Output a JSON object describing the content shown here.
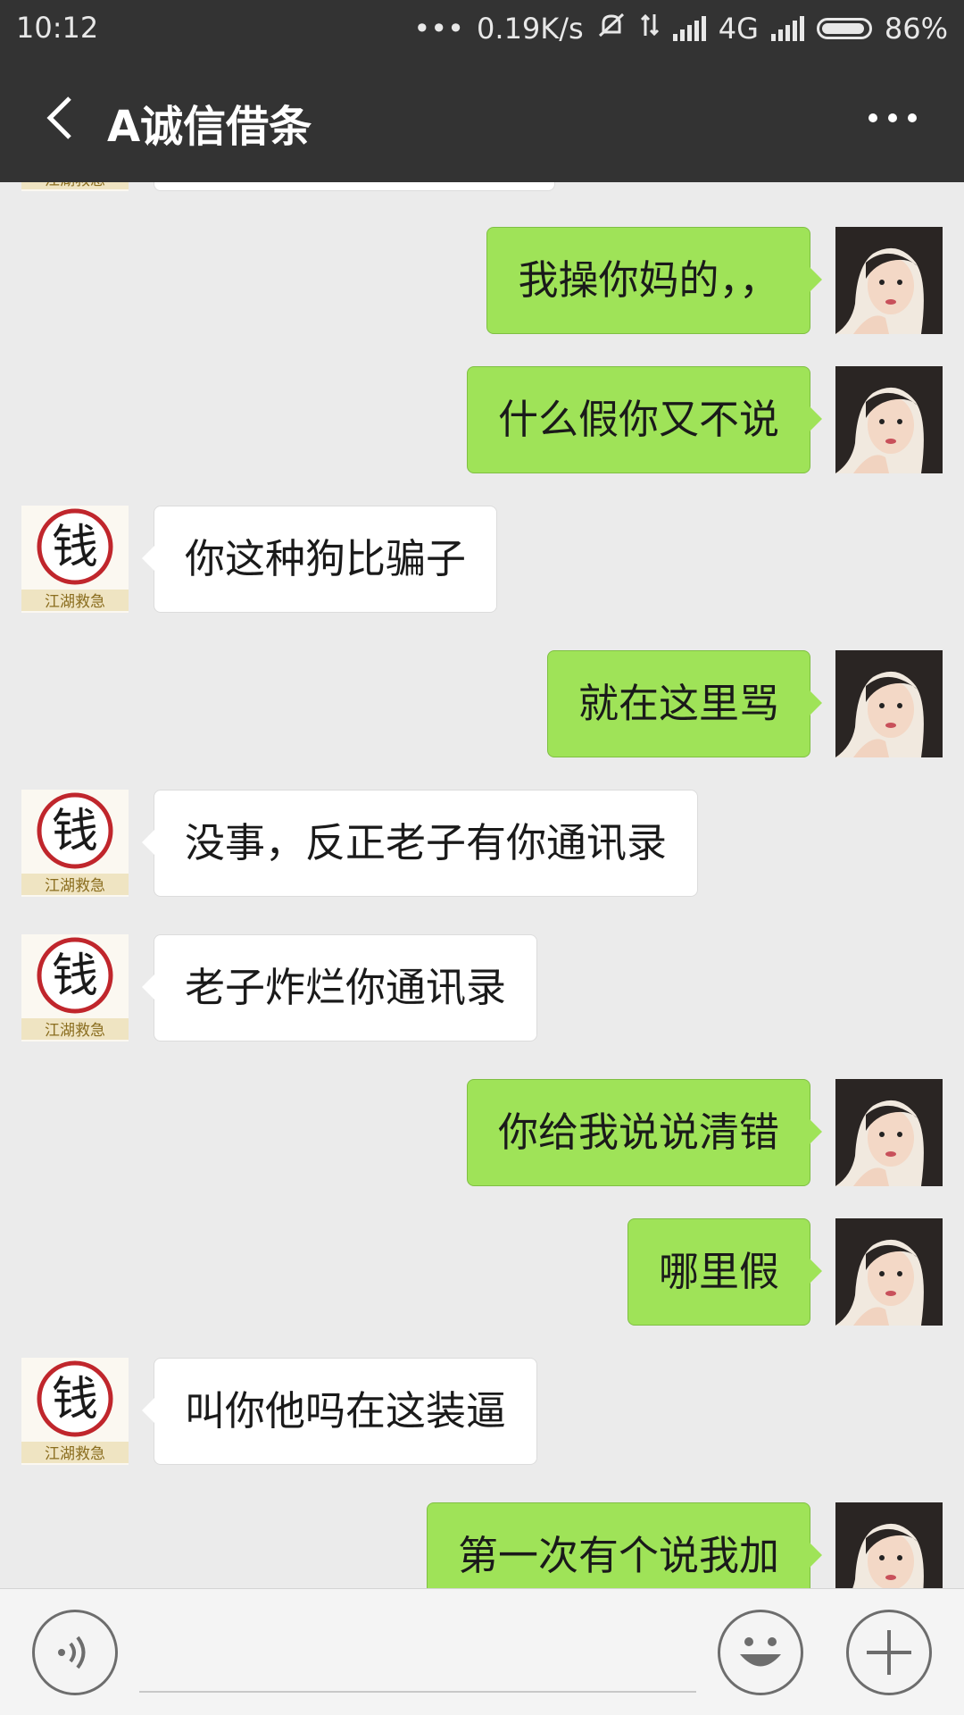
{
  "status_bar": {
    "time": "10:12",
    "dots": "•••",
    "network_speed": "0.19K/s",
    "network_type": "4G",
    "battery": "86%"
  },
  "header": {
    "title": "A诚信借条",
    "back_icon": "chevron-left-icon",
    "more_icon": "more-dots-icon"
  },
  "colors": {
    "header_bg": "#333333",
    "chat_bg": "#ebebeb",
    "my_bubble": "#9fe358",
    "their_bubble": "#ffffff",
    "avatar_badge_red": "#c0262c"
  },
  "contact_avatar": {
    "badge_char": "钱",
    "caption": "江湖救急"
  },
  "messages": [
    {
      "sender": "me",
      "text": "我操你妈的，，"
    },
    {
      "sender": "me",
      "text": "什么假你又不说"
    },
    {
      "sender": "them",
      "text": "你这种狗比骗子"
    },
    {
      "sender": "me",
      "text": "就在这里骂"
    },
    {
      "sender": "them",
      "text": "没事，反正老子有你通讯录"
    },
    {
      "sender": "them",
      "text": "老子炸烂你通讯录"
    },
    {
      "sender": "me",
      "text": "你给我说说清错"
    },
    {
      "sender": "me",
      "text": "哪里假"
    },
    {
      "sender": "them",
      "text": "叫你他吗在这装逼"
    },
    {
      "sender": "me",
      "text": "第一次有个说我加"
    }
  ],
  "input_bar": {
    "voice_icon": "voice-icon",
    "emoji_icon": "emoji-icon",
    "plus_icon": "plus-icon"
  }
}
